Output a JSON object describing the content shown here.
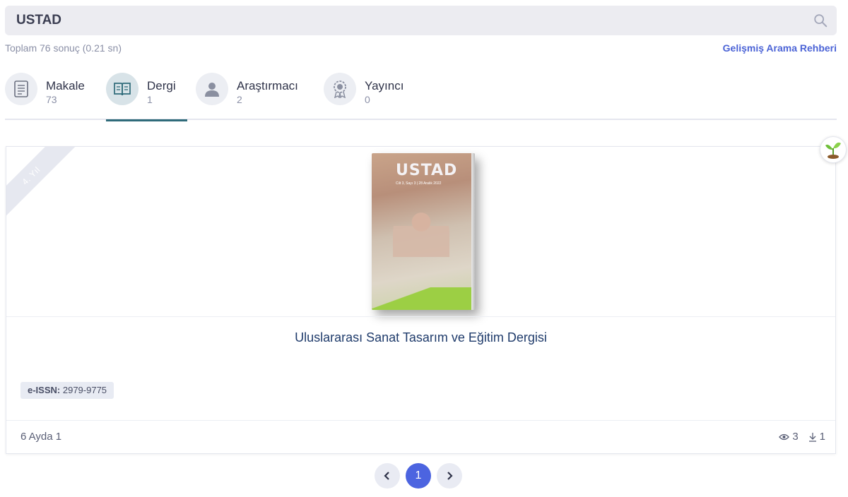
{
  "search": {
    "value": "USTAD",
    "icon": "search-icon"
  },
  "results": {
    "summary": "Toplam 76 sonuç (0.21 sn)",
    "advanced_guide": "Gelişmiş Arama Rehberi"
  },
  "tabs": [
    {
      "label": "Makale",
      "count": "73",
      "icon": "document-icon",
      "active": false
    },
    {
      "label": "Dergi",
      "count": "1",
      "icon": "journal-icon",
      "active": true
    },
    {
      "label": "Araştırmacı",
      "count": "2",
      "icon": "user-icon",
      "active": false
    },
    {
      "label": "Yayıncı",
      "count": "0",
      "icon": "award-icon",
      "active": false
    }
  ],
  "card": {
    "ribbon": "4. Yıl",
    "cover": {
      "title": "USTAD",
      "subtitle": "Cilt 3, Sayı 3 | 28 Aralık 2022"
    },
    "journal_title": "Uluslararası Sanat Tasarım ve Eğitim Dergisi",
    "issn_label": "e-ISSN:",
    "issn_value": "2979-9775",
    "frequency": "6 Ayda 1",
    "views": "3",
    "downloads": "1"
  },
  "pagination": {
    "prev": "‹",
    "current": "1",
    "next": "›"
  },
  "colors": {
    "accent": "#4c64e0",
    "tab_underline": "#2f6b7a",
    "title": "#1f3b6b"
  }
}
